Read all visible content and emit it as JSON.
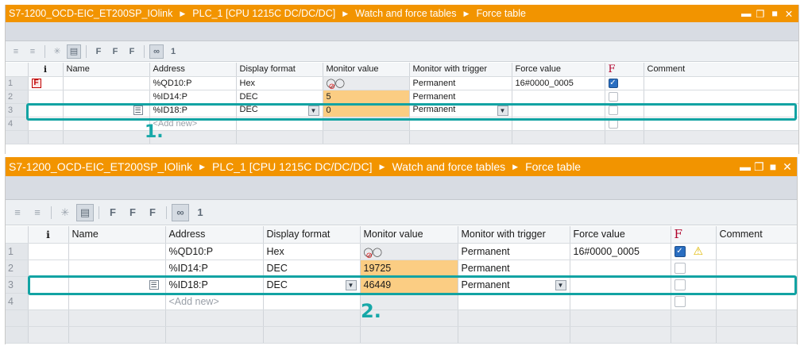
{
  "colors": {
    "title_bar": "#f29400",
    "monitor_highlight": "#fbcd83",
    "callout": "#12a3a3",
    "force_flag": "#b0002a"
  },
  "breadcrumb": [
    "S7-1200_OCD-EIC_ET200SP_IOlink",
    "PLC_1 [CPU 1215C DC/DC/DC]",
    "Watch and force tables",
    "Force table"
  ],
  "window_buttons": [
    "minimize-icon",
    "restore-icon",
    "maximize-icon",
    "close-icon"
  ],
  "toolbar_icons": [
    "force-all-icon",
    "force-selected-icon",
    "stop-force-icon",
    "show-hide-columns-icon",
    "force-icon",
    "force-start-icon",
    "force-stop-icon",
    "monitor-all-icon",
    "monitor-once-icon"
  ],
  "toolbar_glyphs": {
    "force": "F",
    "force_start": "F",
    "force_stop": "F",
    "monitor_all": "∞",
    "monitor_once": "1"
  },
  "columns": {
    "info": "i",
    "name": "Name",
    "address": "Address",
    "display_format": "Display format",
    "monitor_value": "Monitor value",
    "monitor_trigger": "Monitor with trigger",
    "force_value": "Force value",
    "force_flag": "F",
    "comment": "Comment"
  },
  "panels": [
    {
      "step_label": "1.",
      "rows": [
        {
          "index": "1",
          "address": "%QD10:P",
          "format": "Hex",
          "monitor": "",
          "trigger": "Permanent",
          "force_value": "16#0000_0005",
          "forced": true
        },
        {
          "index": "2",
          "address": "%ID14:P",
          "format": "DEC",
          "monitor": "5",
          "trigger": "Permanent",
          "force_value": "",
          "forced": false
        },
        {
          "index": "3",
          "address": "%ID18:P",
          "format": "DEC",
          "monitor": "0",
          "trigger": "Permanent",
          "force_value": "",
          "forced": false
        },
        {
          "index": "4",
          "address": "<Add new>"
        }
      ]
    },
    {
      "step_label": "2.",
      "rows": [
        {
          "index": "1",
          "address": "%QD10:P",
          "format": "Hex",
          "monitor": "",
          "trigger": "Permanent",
          "force_value": "16#0000_0005",
          "forced": true
        },
        {
          "index": "2",
          "address": "%ID14:P",
          "format": "DEC",
          "monitor": "19725",
          "trigger": "Permanent",
          "force_value": "",
          "forced": false
        },
        {
          "index": "3",
          "address": "%ID18:P",
          "format": "DEC",
          "monitor": "46449",
          "trigger": "Permanent",
          "force_value": "",
          "forced": false
        },
        {
          "index": "4",
          "address": "<Add new>"
        }
      ]
    }
  ]
}
